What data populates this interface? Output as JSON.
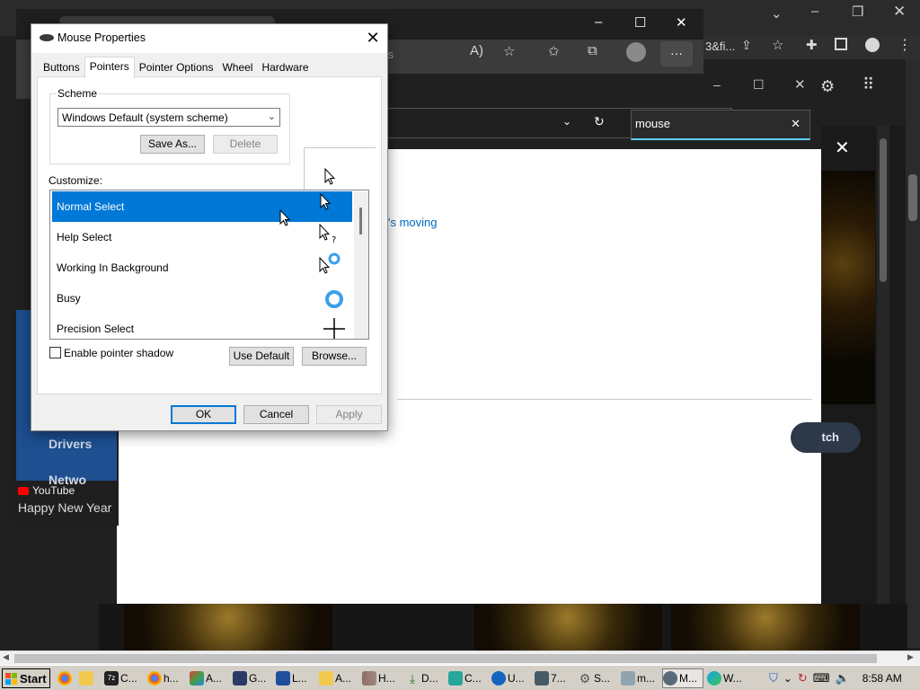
{
  "background": {
    "edge_toolbar_text": "ows",
    "edge_more": "···",
    "chrome_url_fragment": "3&fi...",
    "settings_search_value": "mouse",
    "settings_link": "'s moving",
    "search_pill": "tch",
    "youtube_card": {
      "menu_item_1": "Drivers",
      "menu_item_2": "Netwo",
      "source": "YouTube",
      "title": "Happy New Year"
    }
  },
  "dialog": {
    "title": "Mouse Properties",
    "tabs": [
      "Buttons",
      "Pointers",
      "Pointer Options",
      "Wheel",
      "Hardware"
    ],
    "active_tab": "Pointers",
    "scheme": {
      "label": "Scheme",
      "selected": "Windows Default (system scheme)",
      "save_as_label": "Save As...",
      "delete_label": "Delete"
    },
    "customize_label": "Customize:",
    "cursor_list": [
      {
        "label": "Normal Select",
        "cursor": "arrow-cursor-icon",
        "selected": true
      },
      {
        "label": "Help Select",
        "cursor": "help-cursor-icon",
        "selected": false
      },
      {
        "label": "Working In Background",
        "cursor": "working-cursor-icon",
        "selected": false
      },
      {
        "label": "Busy",
        "cursor": "busy-cursor-icon",
        "selected": false
      },
      {
        "label": "Precision Select",
        "cursor": "crosshair-cursor-icon",
        "selected": false
      }
    ],
    "enable_shadow_label": "Enable pointer shadow",
    "enable_shadow_checked": false,
    "use_default_label": "Use Default",
    "browse_label": "Browse...",
    "ok_label": "OK",
    "cancel_label": "Cancel",
    "apply_label": "Apply"
  },
  "taskbar": {
    "start_label": "Start",
    "items": [
      {
        "icon": "chrome-icon",
        "label": ""
      },
      {
        "icon": "folder-icon",
        "label": ""
      },
      {
        "icon": "7zip-icon",
        "label": "C..."
      },
      {
        "icon": "chrome-icon",
        "label": "h..."
      },
      {
        "icon": "app-icon",
        "label": "A..."
      },
      {
        "icon": "app-icon",
        "label": "G..."
      },
      {
        "icon": "app-icon",
        "label": "L..."
      },
      {
        "icon": "folder-icon",
        "label": "A..."
      },
      {
        "icon": "archive-icon",
        "label": "H..."
      },
      {
        "icon": "download-icon",
        "label": "D..."
      },
      {
        "icon": "app-icon",
        "label": "C..."
      },
      {
        "icon": "app-icon",
        "label": "U..."
      },
      {
        "icon": "monitor-icon",
        "label": "7..."
      },
      {
        "icon": "gear-icon",
        "label": "S..."
      },
      {
        "icon": "app-icon",
        "label": "m..."
      },
      {
        "icon": "mouse-icon",
        "label": "M..."
      },
      {
        "icon": "edge-icon",
        "label": "W..."
      }
    ],
    "clock": "8:58 AM"
  },
  "colors": {
    "accent": "#0078d7",
    "selected_row": "#0078d7",
    "busy_ring": "#3aa0ea",
    "taskbar": "#d4d0c8",
    "dark_bg": "#202020"
  }
}
